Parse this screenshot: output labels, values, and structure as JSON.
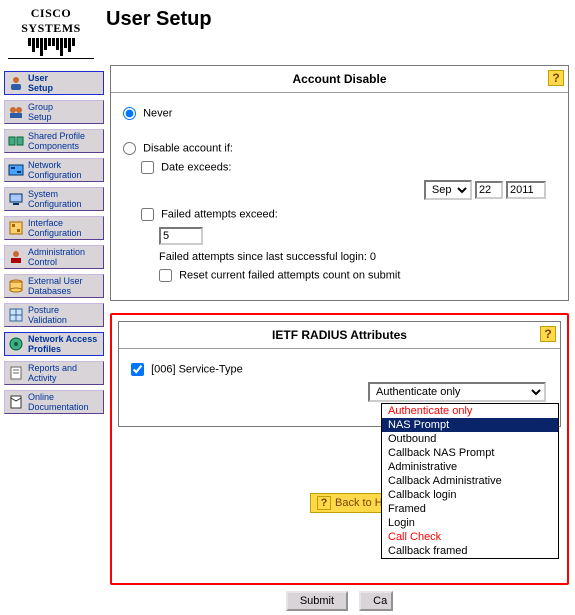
{
  "logo": "CISCO SYSTEMS",
  "page_title": "User Setup",
  "sidebar": {
    "items": [
      {
        "label": "User\nSetup"
      },
      {
        "label": "Group\nSetup"
      },
      {
        "label": "Shared Profile\nComponents"
      },
      {
        "label": "Network\nConfiguration"
      },
      {
        "label": "System\nConfiguration"
      },
      {
        "label": "Interface\nConfiguration"
      },
      {
        "label": "Administration\nControl"
      },
      {
        "label": "External User\nDatabases"
      },
      {
        "label": "Posture\nValidation"
      },
      {
        "label": "Network Access\nProfiles"
      },
      {
        "label": "Reports and\nActivity"
      },
      {
        "label": "Online\nDocumentation"
      }
    ]
  },
  "account_panel": {
    "title": "Account Disable",
    "never": "Never",
    "disable_if": "Disable account if:",
    "date_exceeds": "Date exceeds:",
    "month": "Sep",
    "day": "22",
    "year": "2011",
    "failed_exceed": "Failed attempts exceed:",
    "fail_count": "5",
    "since_last": "Failed attempts since last successful login: 0",
    "reset": "Reset current failed attempts count on submit"
  },
  "radius_panel": {
    "title": "IETF RADIUS Attributes",
    "service_type": "[006] Service-Type",
    "selected": "Authenticate only",
    "options": [
      {
        "t": "Authenticate only",
        "cls": "red"
      },
      {
        "t": "NAS Prompt",
        "cls": "hl"
      },
      {
        "t": "Outbound",
        "cls": ""
      },
      {
        "t": "Callback NAS Prompt",
        "cls": ""
      },
      {
        "t": "Administrative",
        "cls": ""
      },
      {
        "t": "Callback Administrative",
        "cls": ""
      },
      {
        "t": "Callback login",
        "cls": ""
      },
      {
        "t": "Framed",
        "cls": ""
      },
      {
        "t": "Login",
        "cls": ""
      },
      {
        "t": "Call Check",
        "cls": "red"
      },
      {
        "t": "Callback framed",
        "cls": ""
      }
    ]
  },
  "buttons": {
    "back": "Back to Help",
    "submit": "Submit",
    "cancel": "Cancel"
  }
}
